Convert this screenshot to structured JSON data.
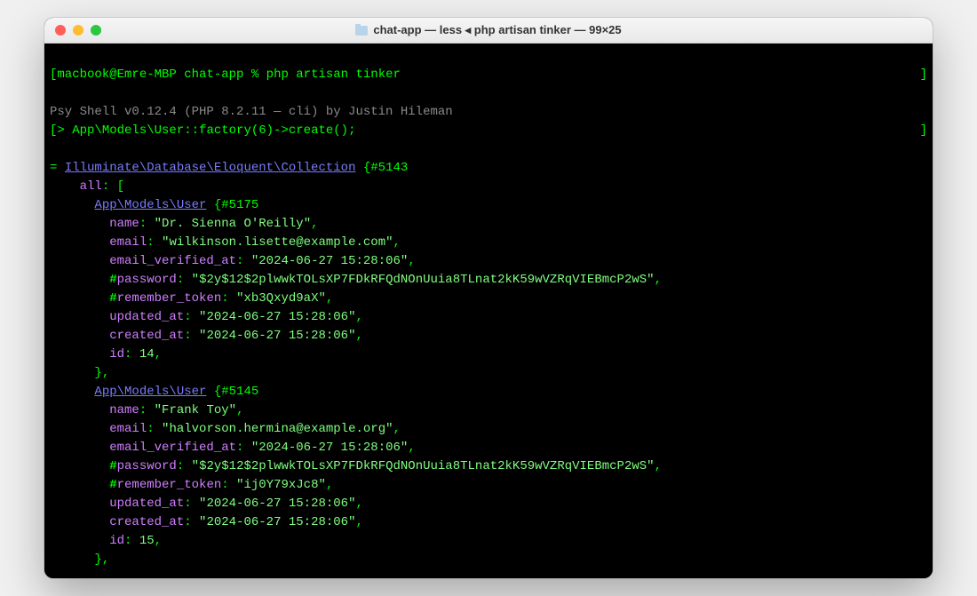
{
  "window": {
    "title": "chat-app — less ◂ php artisan tinker — 99×25"
  },
  "prompt": {
    "open": "[",
    "userhost": "macbook@Emre-MBP",
    "dir": "chat-app",
    "sep": " % ",
    "cmd": "php artisan tinker",
    "close": "]"
  },
  "shell_banner": "Psy Shell v0.12.4 (PHP 8.2.11 — cli) by Justin Hileman",
  "entry": {
    "open": "[",
    "caret": "> ",
    "code": "App\\Models\\User::factory(6)->create();",
    "close": "]"
  },
  "result": {
    "eq": "= ",
    "collection_class": "Illuminate\\Database\\Eloquent\\Collection",
    "collection_hash": "#5143",
    "all_label": "all",
    "user_class": "App\\Models\\User",
    "records": [
      {
        "hash": "#5175",
        "name": "Dr. Sienna O'Reilly",
        "email": "wilkinson.lisette@example.com",
        "email_verified_at": "2024-06-27 15:28:06",
        "password": "$2y$12$2plwwkTOLsXP7FDkRFQdNOnUuia8TLnat2kK59wVZRqVIEBmcP2wS",
        "remember_token": "xb3Qxyd9aX",
        "updated_at": "2024-06-27 15:28:06",
        "created_at": "2024-06-27 15:28:06",
        "id": 14
      },
      {
        "hash": "#5145",
        "name": "Frank Toy",
        "email": "halvorson.hermina@example.org",
        "email_verified_at": "2024-06-27 15:28:06",
        "password": "$2y$12$2plwwkTOLsXP7FDkRFQdNOnUuia8TLnat2kK59wVZRqVIEBmcP2wS",
        "remember_token": "ij0Y79xJc8",
        "updated_at": "2024-06-27 15:28:06",
        "created_at": "2024-06-27 15:28:06",
        "id": 15
      }
    ]
  },
  "labels": {
    "name": "name",
    "email": "email",
    "email_verified_at": "email_verified_at",
    "password": "password",
    "remember_token": "remember_token",
    "updated_at": "updated_at",
    "created_at": "created_at",
    "id": "id"
  }
}
